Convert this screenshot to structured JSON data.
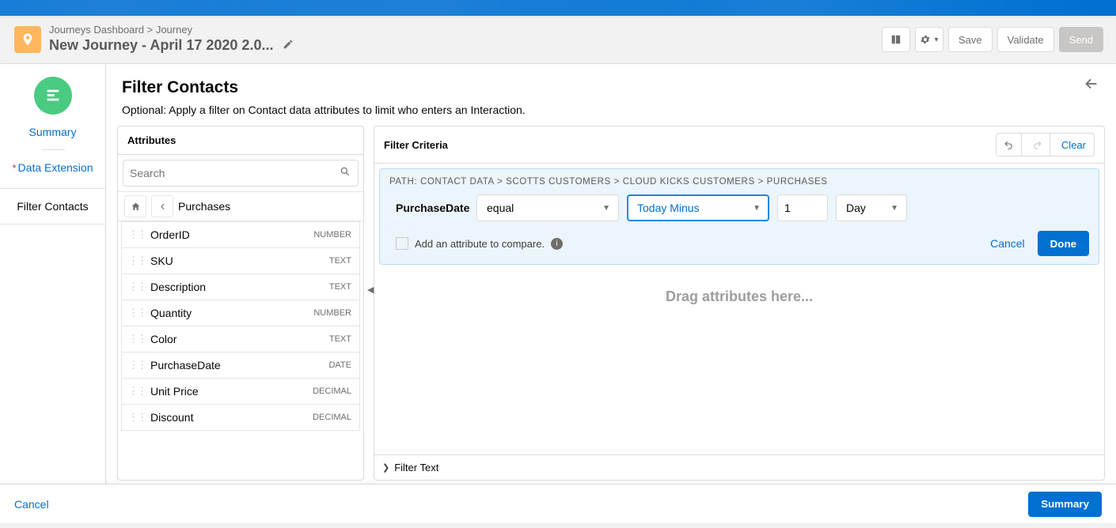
{
  "header": {
    "breadcrumb_parent": "Journeys Dashboard",
    "breadcrumb_current": "Journey",
    "title": "New Journey - April 17 2020 2.0...",
    "actions": {
      "save": "Save",
      "validate": "Validate",
      "send": "Send"
    }
  },
  "left_nav": {
    "summary": "Summary",
    "data_extension": "Data Extension",
    "filter_contacts": "Filter Contacts"
  },
  "page": {
    "title": "Filter Contacts",
    "subtitle": "Optional: Apply a filter on Contact data attributes to limit who enters an Interaction."
  },
  "attributes_panel": {
    "title": "Attributes",
    "search_placeholder": "Search",
    "breadcrumb": "Purchases",
    "items": [
      {
        "name": "OrderID",
        "type": "NUMBER"
      },
      {
        "name": "SKU",
        "type": "TEXT"
      },
      {
        "name": "Description",
        "type": "TEXT"
      },
      {
        "name": "Quantity",
        "type": "NUMBER"
      },
      {
        "name": "Color",
        "type": "TEXT"
      },
      {
        "name": "PurchaseDate",
        "type": "DATE"
      },
      {
        "name": "Unit Price",
        "type": "DECIMAL"
      },
      {
        "name": "Discount",
        "type": "DECIMAL"
      }
    ]
  },
  "criteria_panel": {
    "title": "Filter Criteria",
    "clear": "Clear",
    "path": "PATH: CONTACT DATA > SCOTTS CUSTOMERS > CLOUD KICKS CUSTOMERS > PURCHASES",
    "field_label": "PurchaseDate",
    "operator": "equal",
    "relative": "Today Minus",
    "number": "1",
    "unit": "Day",
    "compare_text": "Add an attribute to compare.",
    "cancel": "Cancel",
    "done": "Done",
    "drop_hint": "Drag attributes here...",
    "filter_text": "Filter Text"
  },
  "footer": {
    "cancel": "Cancel",
    "summary": "Summary"
  }
}
